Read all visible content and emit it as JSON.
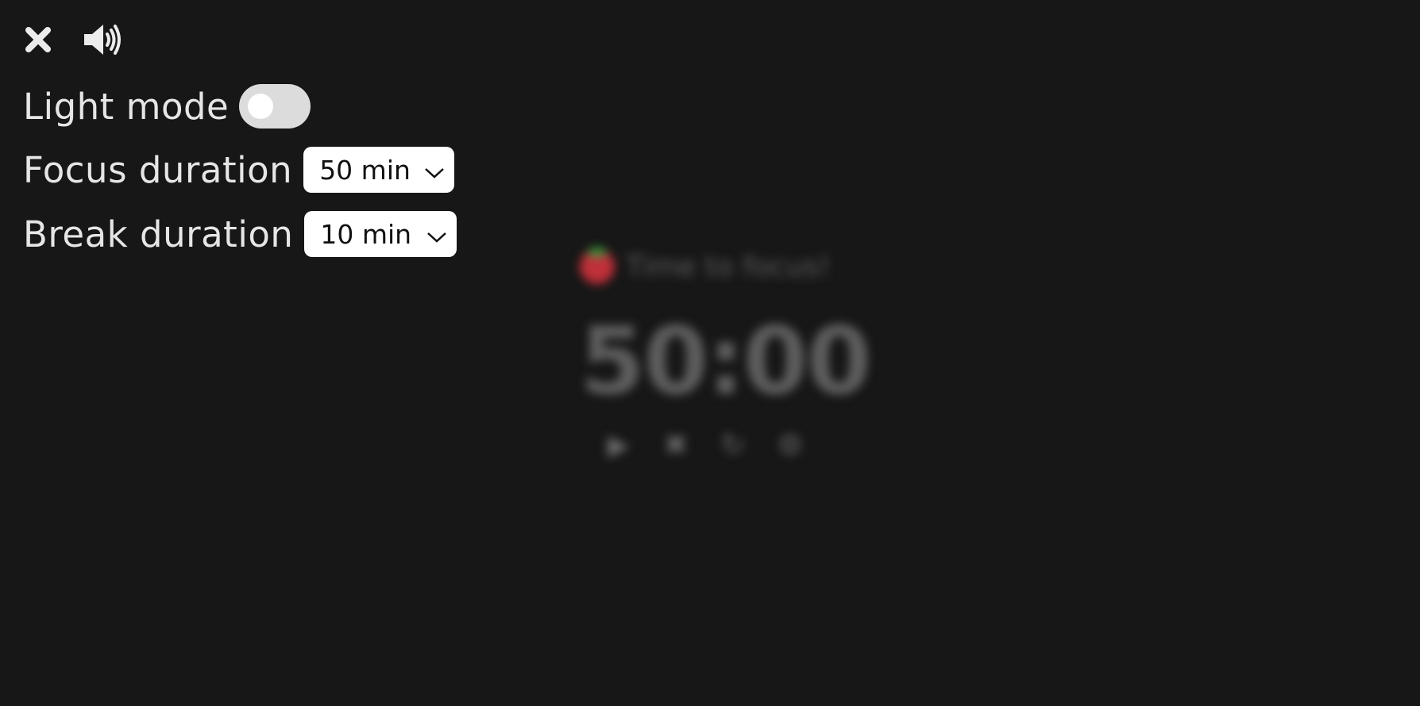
{
  "settings": {
    "light_mode_label": "Light mode",
    "light_mode_on": false,
    "focus_label": "Focus duration",
    "focus_value": "50 min",
    "break_label": "Break duration",
    "break_value": "10 min"
  },
  "timer": {
    "label": "Time to focus!",
    "display": "50:00"
  },
  "icons": {
    "close": "close-icon",
    "volume": "volume-icon",
    "play": "play-icon",
    "stop": "stop-icon",
    "reset": "reset-icon",
    "settings": "settings-icon"
  },
  "colors": {
    "background": "#171717",
    "text": "#e6e6e6",
    "toggle_track": "#dcdcdc",
    "tomato": "#c0303a"
  }
}
